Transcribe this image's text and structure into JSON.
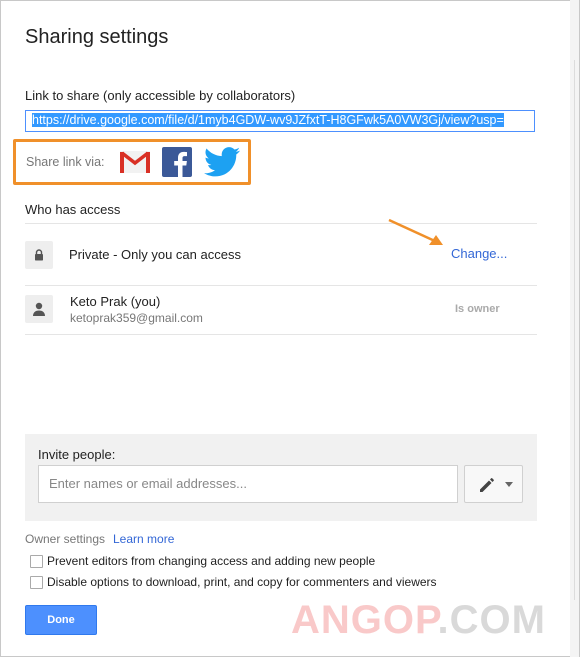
{
  "dialog": {
    "title": "Sharing settings"
  },
  "link": {
    "label": "Link to share (only accessible by collaborators)",
    "url": "https://drive.google.com/file/d/1myb4GDW-wv9JZfxtT-H8GFwk5A0VW3Gj/view?usp="
  },
  "share_via": {
    "label": "Share link via:",
    "icons": [
      "gmail-icon",
      "facebook-icon",
      "twitter-icon"
    ],
    "highlight_color": "#f0902a"
  },
  "access": {
    "heading": "Who has access",
    "visibility": {
      "text": "Private - Only you can access",
      "change_label": "Change...",
      "icon": "lock-icon"
    },
    "owner": {
      "name": "Keto Prak (you)",
      "email": "ketoprak359@gmail.com",
      "role": "Is owner",
      "icon": "person-icon"
    }
  },
  "invite": {
    "label": "Invite people:",
    "placeholder": "Enter names or email addresses...",
    "permission_icon": "pencil-icon"
  },
  "owner_settings": {
    "label": "Owner settings",
    "learn_more": "Learn more",
    "options": [
      {
        "label": "Prevent editors from changing access and adding new people",
        "checked": false
      },
      {
        "label": "Disable options to download, print, and copy for commenters and viewers",
        "checked": false
      }
    ]
  },
  "actions": {
    "done_label": "Done"
  },
  "watermark": {
    "part1": "ANGOP",
    "part2": ".COM"
  },
  "colors": {
    "accent": "#4d90fe",
    "link": "#3367d6",
    "annotation": "#f0902a"
  }
}
